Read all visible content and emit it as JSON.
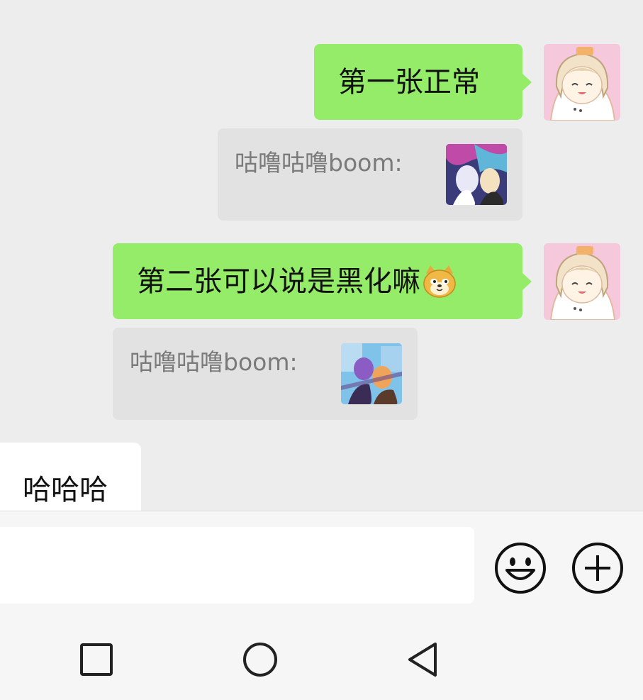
{
  "messages": [
    {
      "side": "out",
      "text": "第一张正常"
    },
    {
      "side": "out",
      "text": "第二张可以说是黑化嘛"
    }
  ],
  "quotes": [
    {
      "sender": "咕噜咕噜boom:",
      "thumb_icon": "anime-image-thumbnail-1"
    },
    {
      "sender": "咕噜咕噜boom:",
      "thumb_icon": "anime-image-thumbnail-2"
    }
  ],
  "incoming": {
    "text": "哈哈哈"
  },
  "emoji": {
    "name": "doge-emoji"
  },
  "input": {
    "value": "",
    "placeholder": ""
  },
  "icons": {
    "emoji_button": "smiley-icon",
    "plus_button": "plus-circle-icon",
    "nav": [
      "square-recent-icon",
      "circle-home-icon",
      "triangle-back-icon"
    ]
  },
  "colors": {
    "chat_background": "#ededed",
    "outgoing_bubble": "#95ec69",
    "quote_background": "#e2e2e2",
    "quote_text": "#7a7a7a"
  }
}
